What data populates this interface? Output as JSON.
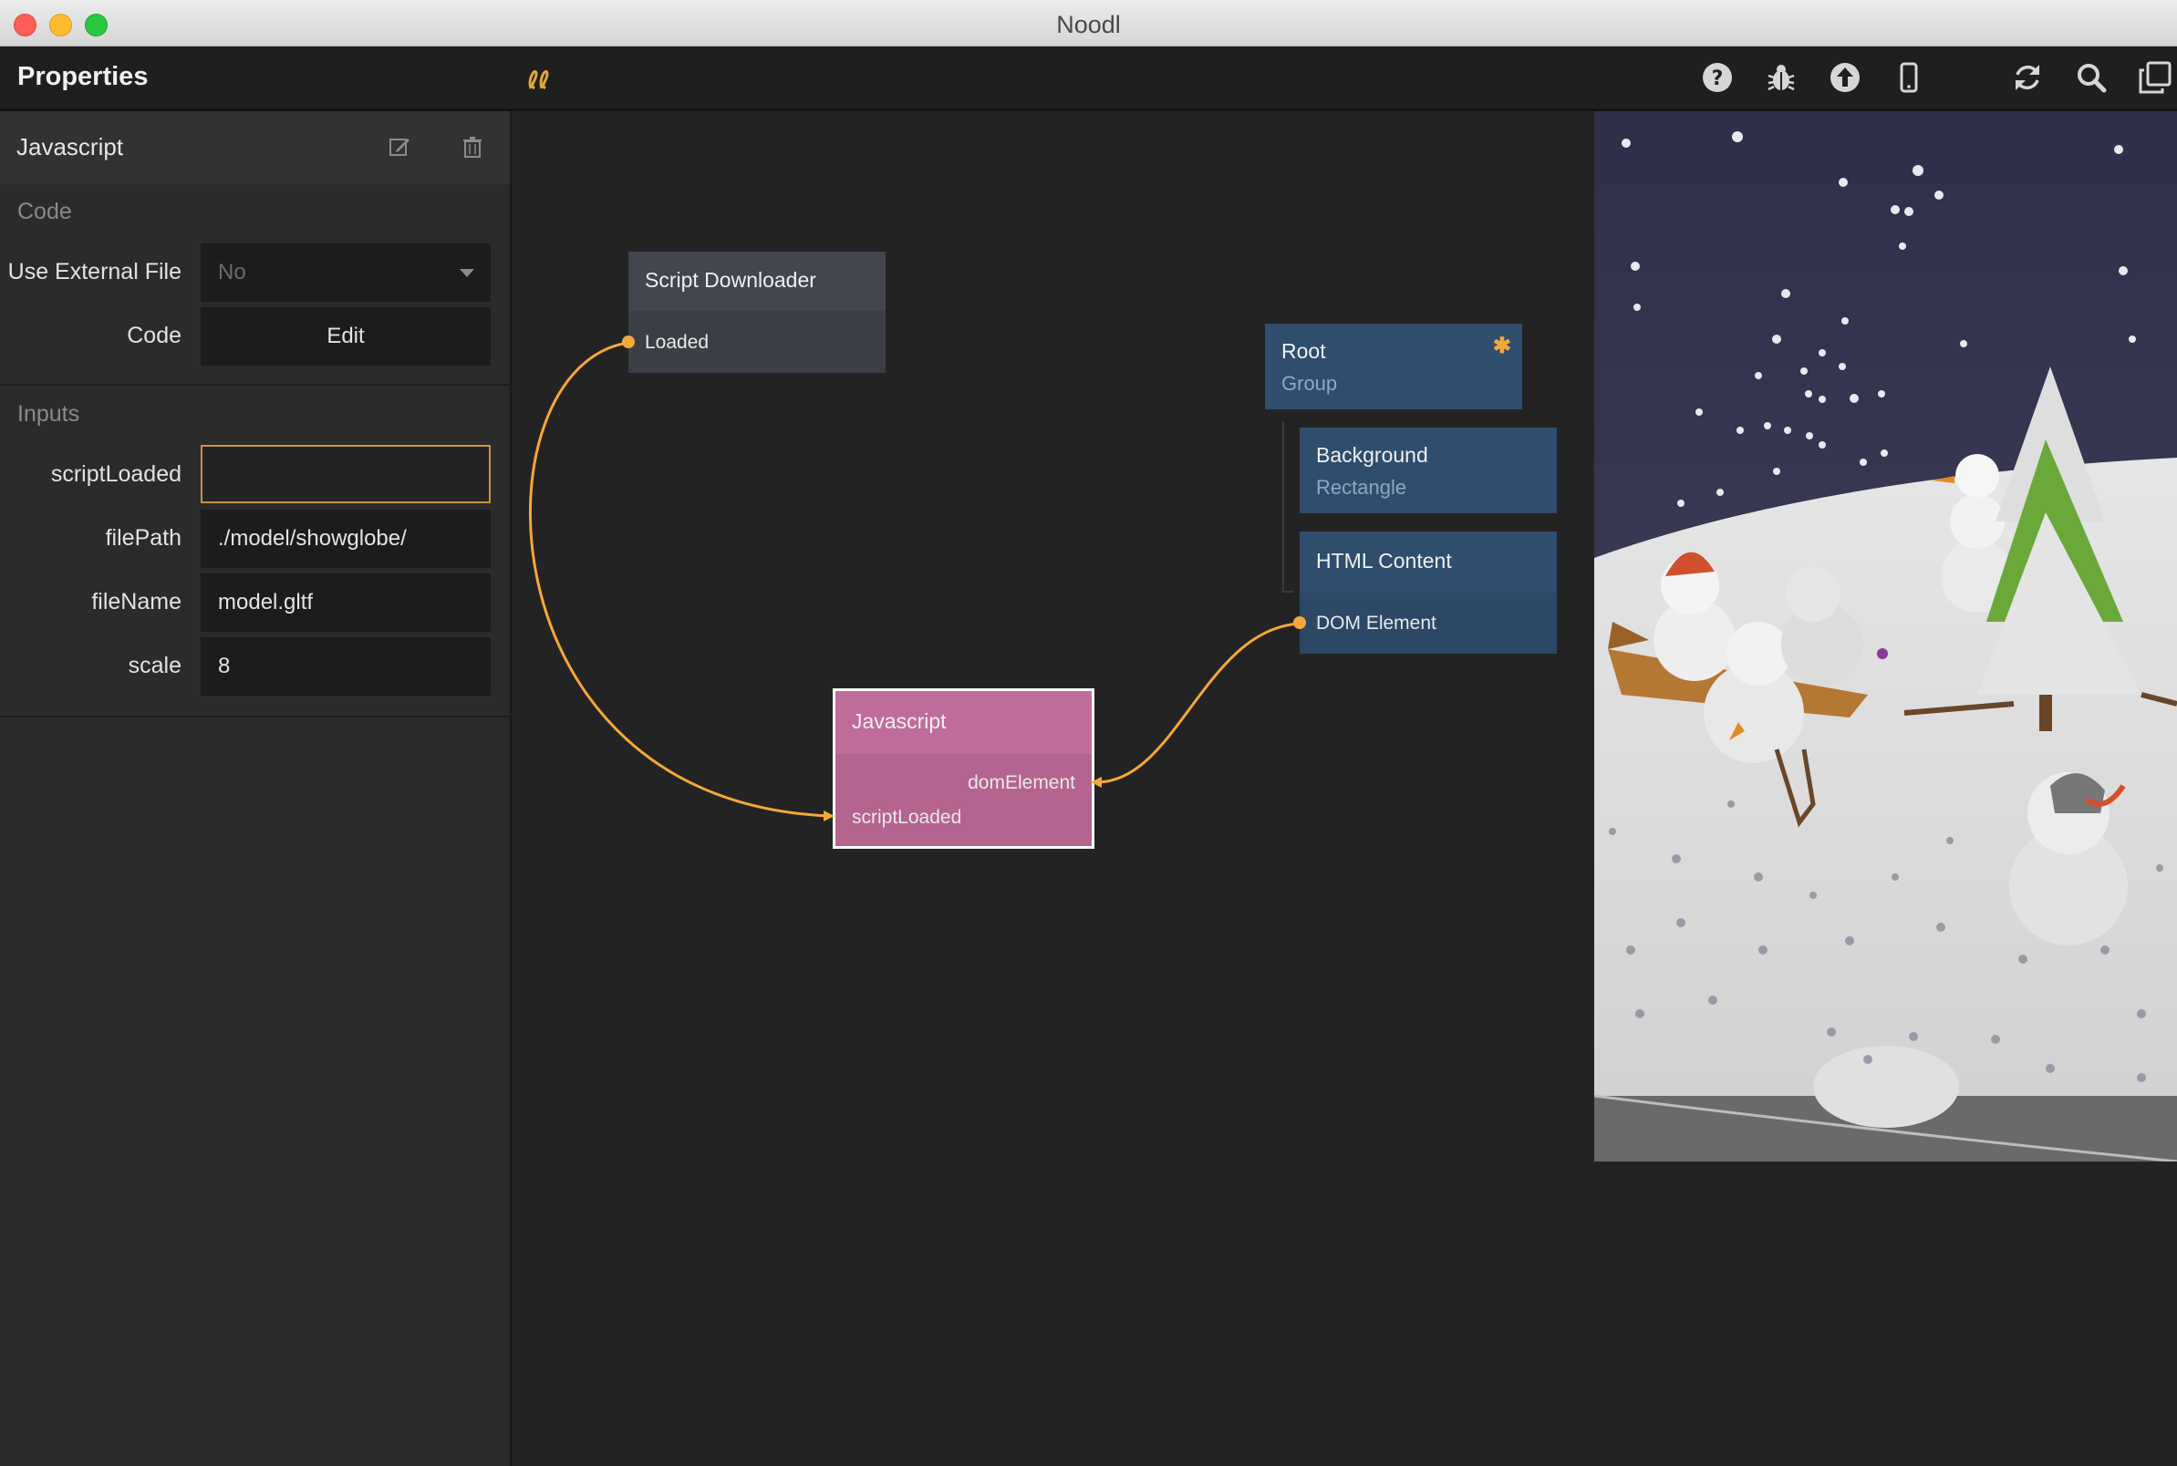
{
  "window": {
    "title": "Noodl"
  },
  "toolbar": {
    "title": "Properties",
    "logo_icon": "noodl-logo-icon",
    "right_icons": [
      "help-icon",
      "bug-icon",
      "upload-icon",
      "mobile-device-icon",
      "refresh-icon",
      "search-icon",
      "copy-window-icon"
    ]
  },
  "panel": {
    "node_name": "Javascript",
    "sections": {
      "code": "Code",
      "inputs": "Inputs"
    },
    "props": {
      "use_external_file": {
        "label": "Use External File",
        "value": "No"
      },
      "code": {
        "label": "Code",
        "value": "Edit"
      },
      "script_loaded": {
        "label": "scriptLoaded",
        "value": ""
      },
      "file_path": {
        "label": "filePath",
        "value": "./model/showglobe/"
      },
      "file_name": {
        "label": "fileName",
        "value": "model.gltf"
      },
      "scale": {
        "label": "scale",
        "value": "8"
      }
    }
  },
  "graph": {
    "script_downloader": {
      "title": "Script Downloader",
      "port": "Loaded"
    },
    "javascript": {
      "title": "Javascript",
      "port_out": "domElement",
      "port_in": "scriptLoaded"
    },
    "root": {
      "title": "Root",
      "type": "Group"
    },
    "background": {
      "title": "Background",
      "type": "Rectangle"
    },
    "html_content": {
      "title": "HTML Content",
      "port": "DOM Element"
    }
  },
  "colors": {
    "accent": "#f4a83a",
    "visual_node": "#2f4d6d",
    "js_node": "#b4648f",
    "logic_node": "#3b3e45"
  }
}
